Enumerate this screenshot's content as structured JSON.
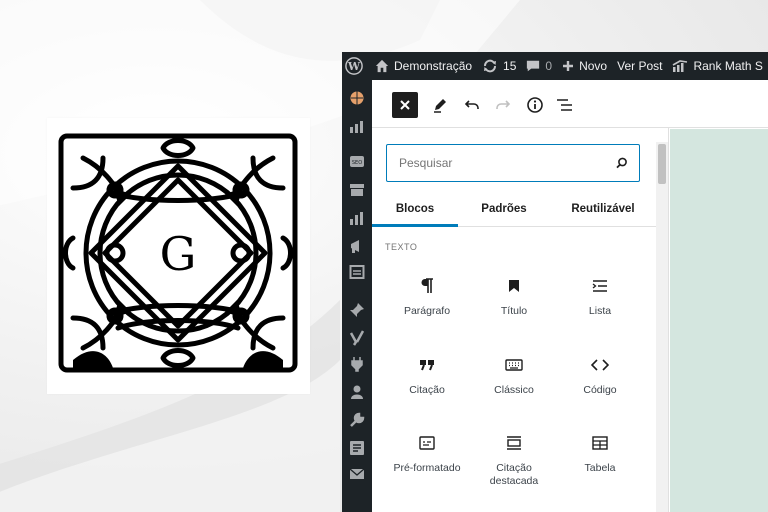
{
  "admin_bar": {
    "site_name": "Demonstração",
    "updates_count": "15",
    "comments_count": "0",
    "new_label": "Novo",
    "view_post_label": "Ver Post",
    "rank_math_label": "Rank Math S"
  },
  "inserter": {
    "search_placeholder": "Pesquisar",
    "tabs": [
      {
        "label": "Blocos",
        "active": true
      },
      {
        "label": "Padrões",
        "active": false
      },
      {
        "label": "Reutilizável",
        "active": false
      }
    ],
    "category_label": "TEXTO",
    "blocks": [
      {
        "label": "Parágrafo",
        "icon": "paragraph-icon"
      },
      {
        "label": "Título",
        "icon": "bookmark-icon"
      },
      {
        "label": "Lista",
        "icon": "list-icon"
      },
      {
        "label": "Citação",
        "icon": "quote-icon"
      },
      {
        "label": "Clássico",
        "icon": "keyboard-icon"
      },
      {
        "label": "Código",
        "icon": "code-icon"
      },
      {
        "label": "Pré-formatado",
        "icon": "preformatted-icon"
      },
      {
        "label": "Citação destacada",
        "icon": "pullquote-icon"
      },
      {
        "label": "Tabela",
        "icon": "table-icon"
      }
    ]
  },
  "colors": {
    "admin_bar": "#1d2327",
    "accent": "#007cba",
    "canvas": "#d4e6df"
  }
}
